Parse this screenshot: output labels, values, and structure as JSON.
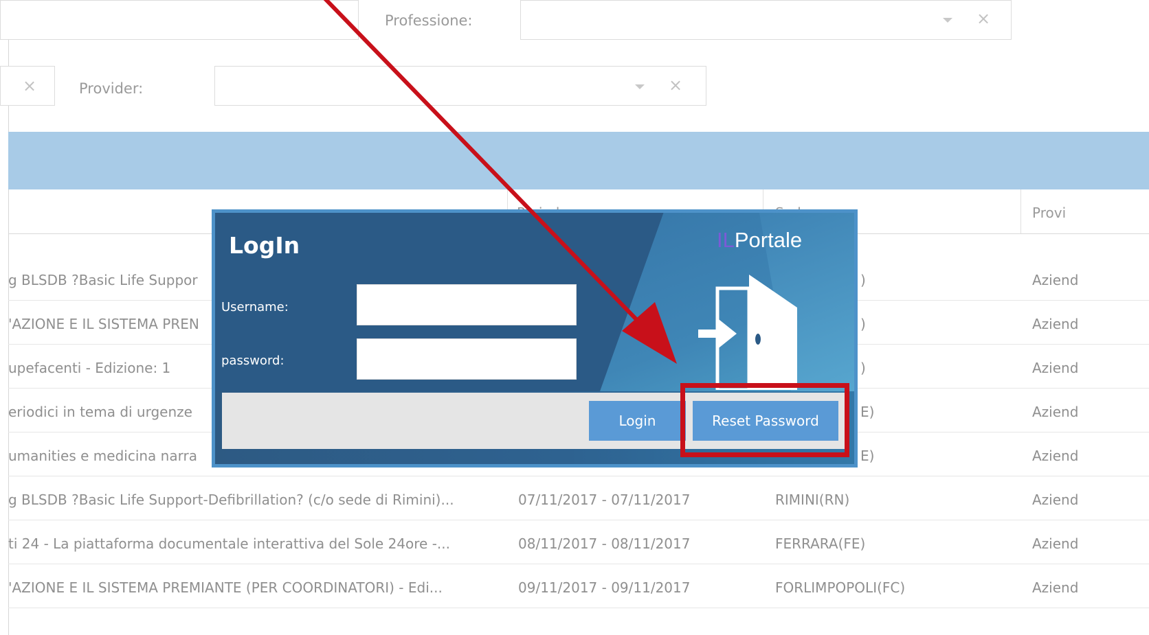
{
  "filters": {
    "professione_label": "Professione:",
    "professione_value": "",
    "provider_label": "Provider:",
    "provider_value": "",
    "clear_icon": "×"
  },
  "table": {
    "headers": [
      "Periodo",
      "Sede",
      "Provi"
    ],
    "rows": [
      {
        "title": "g BLSDB ?Basic Life Suppor",
        "period": "",
        "sede": ")",
        "provider": "Aziend"
      },
      {
        "title": "'AZIONE E IL SISTEMA PREN",
        "period": "",
        "sede": ")",
        "provider": "Aziend"
      },
      {
        "title": "upefacenti - Edizione: 1",
        "period": "",
        "sede": ")",
        "provider": "Aziend"
      },
      {
        "title": "eriodici in tema di urgenze",
        "period": "",
        "sede": "E)",
        "provider": "Aziend"
      },
      {
        "title": "umanities e medicina narra",
        "period": "",
        "sede": "E)",
        "provider": "Aziend"
      },
      {
        "title": "g BLSDB ?Basic Life Support-Defibrillation? (c/o sede di Rimini)...",
        "period": "07/11/2017 - 07/11/2017",
        "sede": "RIMINI(RN)",
        "provider": "Aziend"
      },
      {
        "title": "ti 24 - La piattaforma documentale interattiva del Sole 24ore -...",
        "period": "08/11/2017 - 08/11/2017",
        "sede": "FERRARA(FE)",
        "provider": "Aziend"
      },
      {
        "title": "'AZIONE E IL SISTEMA PREMIANTE (PER COORDINATORI) - Edi...",
        "period": "09/11/2017 - 09/11/2017",
        "sede": "FORLIMPOPOLI(FC)",
        "provider": "Aziend"
      }
    ]
  },
  "login": {
    "title": "LogIn",
    "brand_prefix": "IL",
    "brand_name": "Portale",
    "username_label": "Username:",
    "username_value": "",
    "password_label": "password:",
    "password_value": "",
    "login_button": "Login",
    "reset_button": "Reset Password"
  },
  "annotation": {
    "color": "#c8101a"
  }
}
